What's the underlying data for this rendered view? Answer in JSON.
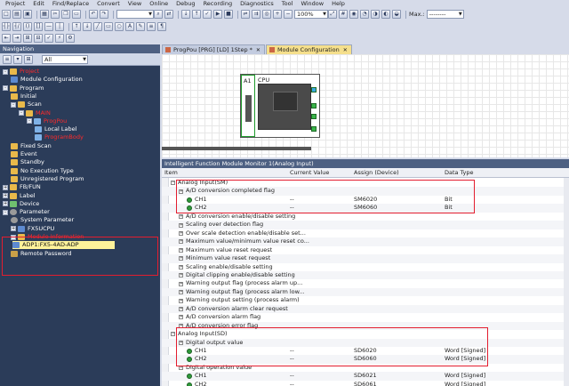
{
  "menu": [
    "Project",
    "Edit",
    "Find/Replace",
    "Convert",
    "View",
    "Online",
    "Debug",
    "Recording",
    "Diagnostics",
    "Tool",
    "Window",
    "Help"
  ],
  "toolbar": {
    "zoom": "100%",
    "max_label": "Max.:",
    "max_value": "--------"
  },
  "navigation": {
    "title": "Navigation",
    "filter": "All",
    "items": [
      {
        "label": "Project",
        "indent": 0,
        "icon": "folder-icon",
        "red": true,
        "exp": "-"
      },
      {
        "label": "Module Configuration",
        "indent": 1,
        "icon": "module-icon"
      },
      {
        "label": "Program",
        "indent": 0,
        "icon": "folder-icon",
        "exp": "-"
      },
      {
        "label": "Initial",
        "indent": 1,
        "icon": "folder-icon"
      },
      {
        "label": "Scan",
        "indent": 1,
        "icon": "folder-icon",
        "exp": "-"
      },
      {
        "label": "MAIN",
        "indent": 2,
        "icon": "folder-icon",
        "red": true,
        "exp": "-"
      },
      {
        "label": "ProgPou",
        "indent": 3,
        "icon": "program-icon",
        "red": true,
        "exp": "-"
      },
      {
        "label": "Local Label",
        "indent": 4,
        "icon": "program-icon"
      },
      {
        "label": "ProgramBody",
        "indent": 4,
        "icon": "program-icon",
        "red": true
      },
      {
        "label": "Fixed Scan",
        "indent": 1,
        "icon": "folder-icon"
      },
      {
        "label": "Event",
        "indent": 1,
        "icon": "folder-icon"
      },
      {
        "label": "Standby",
        "indent": 1,
        "icon": "folder-icon"
      },
      {
        "label": "No Execution Type",
        "indent": 1,
        "icon": "folder-icon"
      },
      {
        "label": "Unregistered Program",
        "indent": 1,
        "icon": "folder-icon"
      },
      {
        "label": "FB/FUN",
        "indent": 0,
        "icon": "folder-icon",
        "exp": "+"
      },
      {
        "label": "Label",
        "indent": 0,
        "icon": "folder-icon",
        "exp": "+"
      },
      {
        "label": "Device",
        "indent": 0,
        "icon": "device-icon",
        "exp": "+"
      },
      {
        "label": "Parameter",
        "indent": 0,
        "icon": "gear-icon",
        "exp": "-"
      },
      {
        "label": "System Parameter",
        "indent": 1,
        "icon": "gear-icon"
      },
      {
        "label": "FX5UCPU",
        "indent": 1,
        "icon": "cpu-icon",
        "exp": "+"
      },
      {
        "label": "Module Information",
        "indent": 1,
        "icon": "folder-icon",
        "red": true,
        "exp": "-"
      },
      {
        "label": "ADP1:FX5-4AD-ADP",
        "indent": 2,
        "icon": "module-icon",
        "selected": true
      },
      {
        "label": "Remote Password",
        "indent": 1,
        "icon": "lock-icon"
      }
    ]
  },
  "tabs": [
    {
      "label": "ProgPou [PRG] [LD] 1Step *",
      "active": false
    },
    {
      "label": "Module Configuration",
      "active": true
    }
  ],
  "module_config": {
    "slot_label": "A1",
    "cpu_label": "CPU"
  },
  "monitor": {
    "title": "Intelligent Function Module Monitor 1(Analog Input)",
    "columns": [
      "Item",
      "Current Value",
      "Assign (Device)",
      "Data Type"
    ],
    "rows": [
      {
        "name": "Analog Input(SM)",
        "level": 0,
        "type": "group"
      },
      {
        "name": "A/D conversion completed flag",
        "level": 1,
        "type": "item"
      },
      {
        "name": "CH1",
        "level": 2,
        "type": "ch",
        "value": "--",
        "device": "SM6020",
        "dtype": "Bit"
      },
      {
        "name": "CH2",
        "level": 2,
        "type": "ch",
        "value": "--",
        "device": "SM6060",
        "dtype": "Bit"
      },
      {
        "name": "A/D conversion enable/disable setting",
        "level": 1,
        "type": "item"
      },
      {
        "name": "Scaling over detection flag",
        "level": 1,
        "type": "item"
      },
      {
        "name": "Over scale detection enable/disable set...",
        "level": 1,
        "type": "item"
      },
      {
        "name": "Maximum value/minimum value reset co...",
        "level": 1,
        "type": "item"
      },
      {
        "name": "Maximum value reset request",
        "level": 1,
        "type": "item"
      },
      {
        "name": "Minimum value reset request",
        "level": 1,
        "type": "item"
      },
      {
        "name": "Scaling enable/disable setting",
        "level": 1,
        "type": "item"
      },
      {
        "name": "Digital clipping enable/disable setting",
        "level": 1,
        "type": "item"
      },
      {
        "name": "Warning output flag (process alarm up...",
        "level": 1,
        "type": "item"
      },
      {
        "name": "Warning output flag (process alarm low...",
        "level": 1,
        "type": "item"
      },
      {
        "name": "Warning output setting (process alarm)",
        "level": 1,
        "type": "item"
      },
      {
        "name": "A/D conversion alarm clear request",
        "level": 1,
        "type": "item"
      },
      {
        "name": "A/D conversion alarm flag",
        "level": 1,
        "type": "item"
      },
      {
        "name": "A/D conversion error flag",
        "level": 1,
        "type": "item"
      },
      {
        "name": "Analog Input(SD)",
        "level": 0,
        "type": "group"
      },
      {
        "name": "Digital output value",
        "level": 1,
        "type": "item"
      },
      {
        "name": "CH1",
        "level": 2,
        "type": "ch",
        "value": "--",
        "device": "SD6020",
        "dtype": "Word [Signed]"
      },
      {
        "name": "CH2",
        "level": 2,
        "type": "ch",
        "value": "--",
        "device": "SD6060",
        "dtype": "Word [Signed]"
      },
      {
        "name": "Digital operation value",
        "level": 1,
        "type": "item"
      },
      {
        "name": "CH1",
        "level": 2,
        "type": "ch",
        "value": "--",
        "device": "SD6021",
        "dtype": "Word [Signed]"
      },
      {
        "name": "CH2",
        "level": 2,
        "type": "ch",
        "value": "--",
        "device": "SD6061",
        "dtype": "Word [Signed]"
      }
    ]
  },
  "colors": {
    "highlight": "#e31d2f",
    "selected_row": "#fdf29a",
    "nav_bg": "#2b3c59",
    "red_text": "#ff2a2a"
  }
}
